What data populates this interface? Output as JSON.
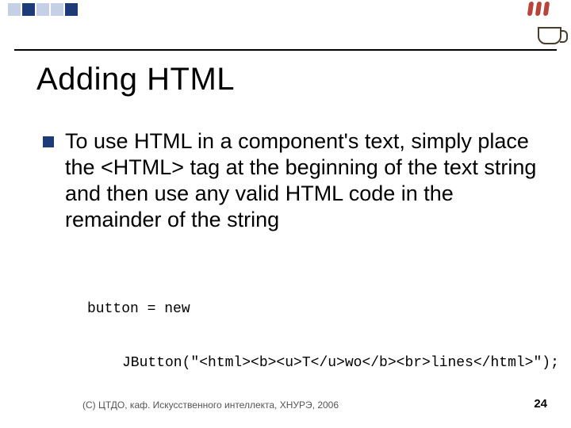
{
  "slide": {
    "title": "Adding HTML",
    "bullet_text": "To use HTML in a component's text, simply place the <HTML> tag at the beginning of the text string and then use any valid HTML code in the remainder of the string",
    "code_line1": "button = new",
    "code_line2": "JButton(\"<html><b><u>T</u>wo</b><br>lines</html>\");",
    "footer": "(С) ЦТДО, каф. Искусственного интеллекта, ХНУРЭ, 2006",
    "page_number": "24"
  },
  "icons": {
    "java_logo": "java-coffee-icon"
  },
  "colors": {
    "accent": "#1d3c77",
    "accent_light": "#c5d0e6"
  }
}
